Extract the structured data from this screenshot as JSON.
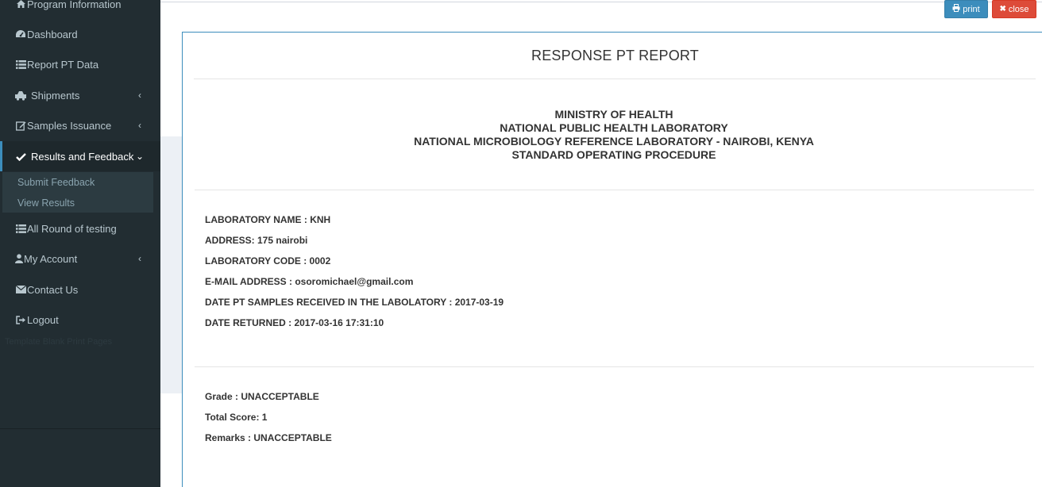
{
  "sidebar": {
    "items": [
      {
        "label": "Program Information",
        "icon": "home-icon"
      },
      {
        "label": "Dashboard",
        "icon": "dashboard-icon"
      },
      {
        "label": "Report PT Data",
        "icon": "list-icon"
      },
      {
        "label": "Shipments",
        "icon": "ambulance-icon"
      },
      {
        "label": "Samples Issuance",
        "icon": "edit-icon"
      },
      {
        "label": "Results and Feedback",
        "icon": "check-icon"
      },
      {
        "label": "All Round of testing",
        "icon": "list-icon"
      },
      {
        "label": "My Account",
        "icon": "user-icon"
      },
      {
        "label": "Contact Us",
        "icon": "envelope-icon"
      },
      {
        "label": "Logout",
        "icon": "sign-out-icon"
      }
    ],
    "submenu": [
      "Submit Feedback",
      "View Results"
    ],
    "faint_text": "Template Blank Print Pages"
  },
  "buttons": {
    "print": "print",
    "close": "close"
  },
  "report": {
    "title": "RESPONSE PT REPORT",
    "heading": [
      "MINISTRY OF HEALTH",
      "NATIONAL PUBLIC HEALTH LABORATORY",
      "NATIONAL MICROBIOLOGY REFERENCE LABORATORY - NAIROBI, KENYA",
      "STANDARD OPERATING PROCEDURE"
    ],
    "info": [
      "LABORATORY NAME : KNH",
      "ADDRESS: 175 nairobi",
      "LABORATORY CODE : 0002",
      "E-MAIL ADDRESS : osoromichael@gmail.com",
      "DATE PT SAMPLES RECEIVED IN THE LABOLATORY : 2017-03-19",
      "DATE RETURNED : 2017-03-16 17:31:10"
    ],
    "results": [
      "Grade : UNACCEPTABLE",
      "Total Score: 1",
      "Remarks : UNACCEPTABLE"
    ]
  },
  "colors": {
    "sidebar_bg": "#222d32",
    "accent": "#3c8dbc",
    "danger": "#dd4b39"
  }
}
